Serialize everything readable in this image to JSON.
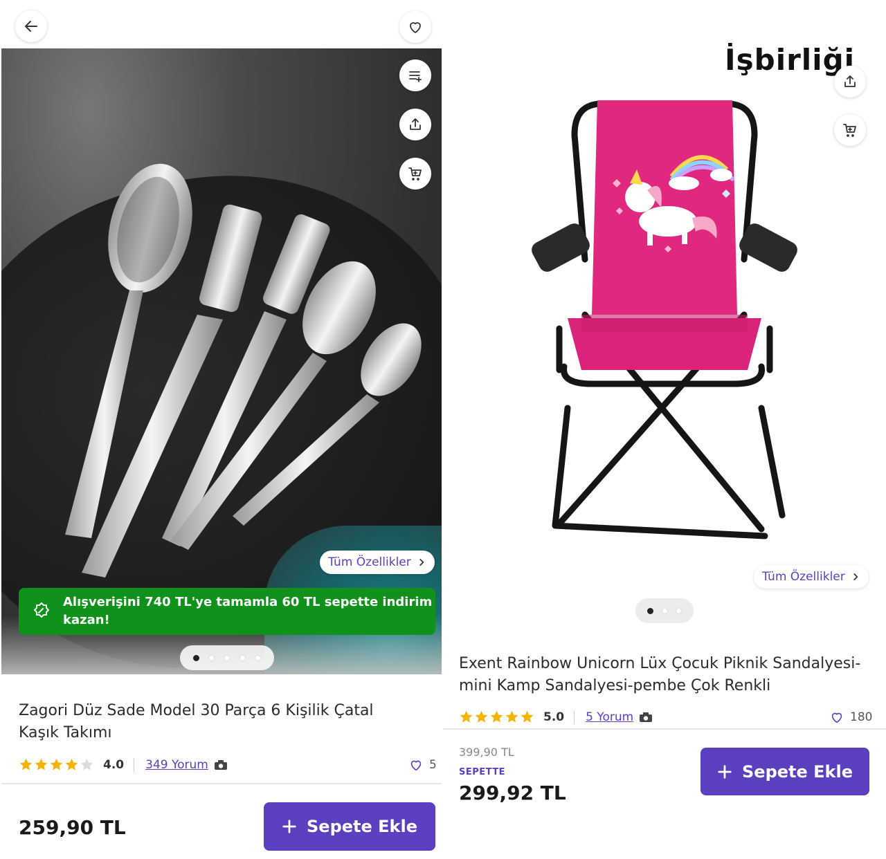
{
  "left": {
    "features_label": "Tüm Özellikler",
    "promo_text": "Alışverişini 740 TL'ye tamamla 60 TL sepette indirim kazan!",
    "carousel": {
      "count": 5,
      "active": 0
    },
    "title": "Zagori Düz Sade Model 30 Parça 6 Kişilik Çatal Kaşık Takımı",
    "rating": {
      "stars": 4,
      "score": "4.0",
      "reviews": "349 Yorum"
    },
    "likes": "5",
    "price": "259,90 TL",
    "add_label": "Sepete Ekle"
  },
  "right": {
    "collab_label": "İşbirliği",
    "features_label": "Tüm Özellikler",
    "carousel": {
      "count": 3,
      "active": 0
    },
    "title": "Exent Rainbow Unicorn Lüx Çocuk Piknik Sandalyesi-mini Kamp Sandalyesi-pembe Çok Renkli",
    "rating": {
      "stars": 5,
      "score": "5.0",
      "reviews": "5 Yorum"
    },
    "likes": "180",
    "old_price": "399,90 TL",
    "basket_label": "SEPETTE",
    "price": "299,92 TL",
    "add_label": "Sepete Ekle"
  },
  "colors": {
    "accent": "#5b3fbf",
    "promo": "#10911c",
    "star": "#f5b400",
    "chair": "#e0287f"
  },
  "icons": [
    "back-arrow-icon",
    "heart-icon",
    "compare-list-icon",
    "share-icon",
    "cart-icon",
    "chevron-right-icon",
    "coupon-icon",
    "star-icon",
    "camera-icon",
    "plus-icon"
  ]
}
